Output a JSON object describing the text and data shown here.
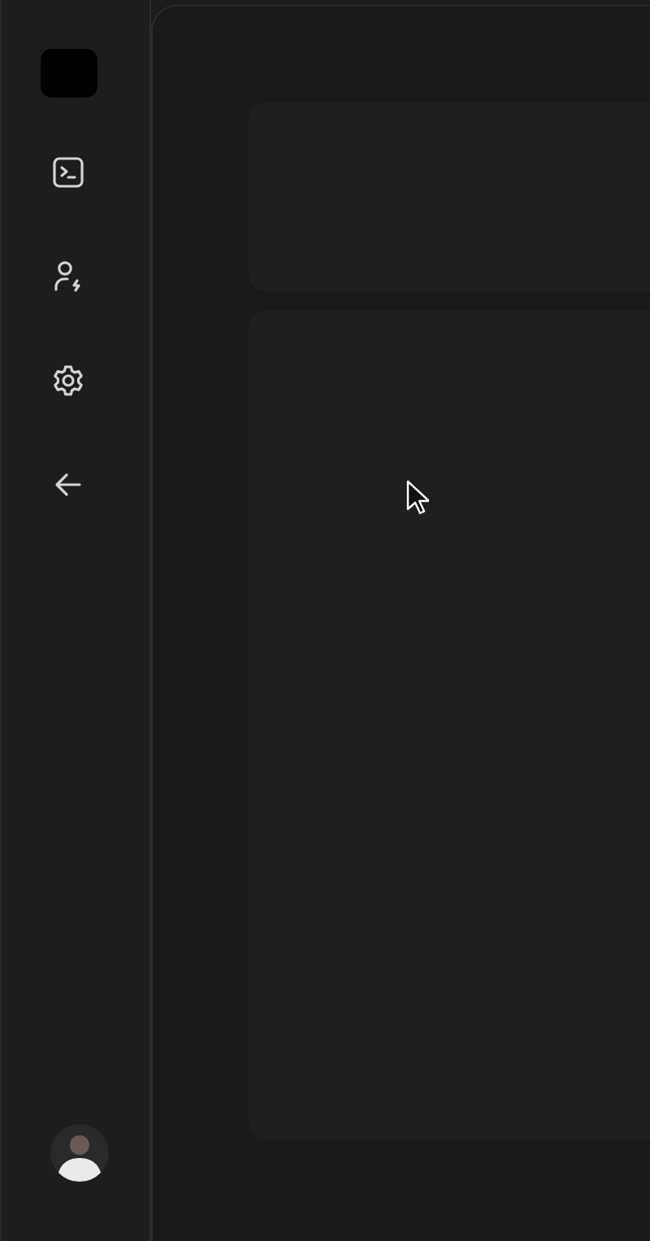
{
  "sidebar": {
    "items": [
      {
        "kind": "logo"
      },
      {
        "kind": "terminal"
      },
      {
        "kind": "user-bolt"
      },
      {
        "kind": "settings"
      },
      {
        "kind": "back"
      },
      {
        "kind": "avatar"
      }
    ]
  },
  "main": {
    "panels": [
      {
        "kind": "header"
      },
      {
        "kind": "body"
      }
    ]
  },
  "cursor": {
    "kind": "arrow"
  }
}
